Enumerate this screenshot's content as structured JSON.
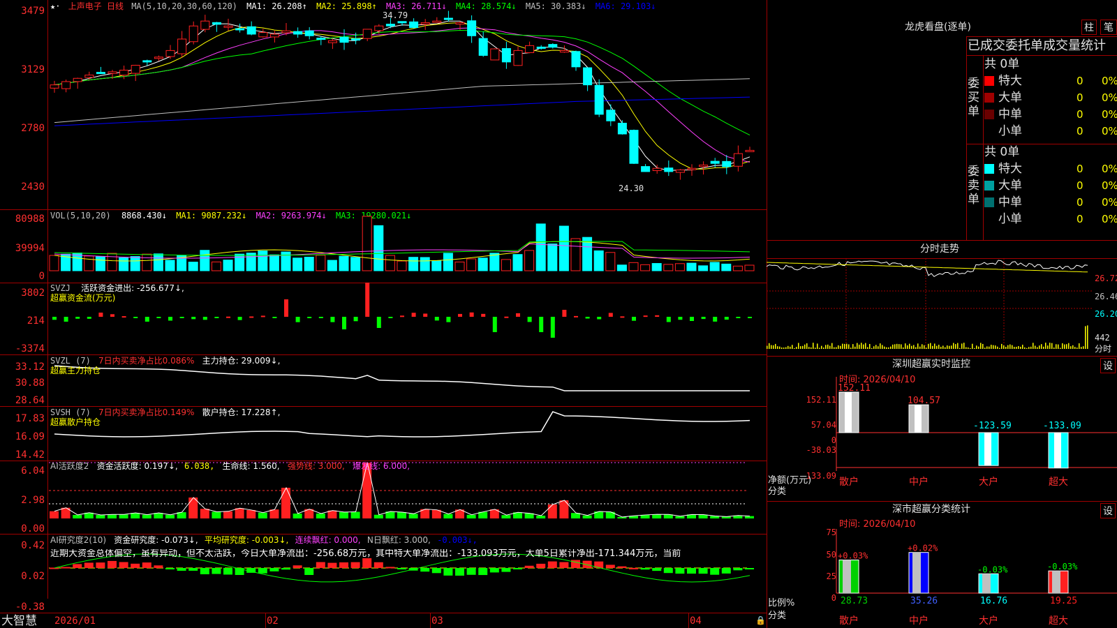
{
  "header": {
    "stock_name": "上声电子",
    "period": "日线",
    "ma_title": "MA(5,10,20,30,60,120)",
    "ma_values": [
      "MA1: 26.208↑",
      "MA2: 25.898↑",
      "MA3: 26.711↓",
      "MA4: 28.574↓",
      "MA5: 30.383↓",
      "MA6: 29.103↓"
    ],
    "high_label": "34.79",
    "low_label": "24.30"
  },
  "price_axis": [
    "3479",
    "3129",
    "2780",
    "2430"
  ],
  "vol": {
    "title": "VOL(5,10,20)",
    "value": "8868.430↓",
    "ma": [
      "MA1: 9087.232↓",
      "MA2: 9263.974↓",
      "MA3: 19280.021↓"
    ],
    "axis": [
      "80988",
      "39994",
      "0"
    ]
  },
  "svzj": {
    "title": "SVZJ",
    "label": "活跃资金进出: -256.677↓,",
    "subtitle": "超赢资金流(万元)",
    "axis": [
      "3802",
      "214",
      "-3374"
    ]
  },
  "svzl": {
    "title": "SVZL (7)",
    "ratio": "7日内买卖净占比0.086%",
    "hold": "主力持仓: 29.009↓,",
    "subtitle": "超赢主力持仓",
    "axis": [
      "33.12",
      "30.88",
      "28.64"
    ]
  },
  "svsh": {
    "title": "SVSH (7)",
    "ratio": "7日内买卖净占比0.149%",
    "hold": "散户持仓: 17.228↑,",
    "subtitle": "超赢散户持仓",
    "axis": [
      "17.83",
      "16.09",
      "14.42"
    ]
  },
  "ai_active": {
    "title": "AI活跃度2",
    "a": "资金活跃度: 0.197↓,",
    "b": "6.038,",
    "c": "生命线: 1.560,",
    "d": "强势线: 3.000,",
    "e": "爆发线: 6.000,",
    "axis": [
      "6.04",
      "2.98",
      "0.00"
    ]
  },
  "ai_research": {
    "title": "AI研究度2(10)",
    "a": "资金研究度: -0.073↓,",
    "b": "平均研究度: -0.003↓,",
    "c": "连续飘红: 0.000,",
    "d": "N日飘红: 3.000,",
    "e": "-0.003↓,",
    "summary": "近期大资金总体偏空，虽有异动，但不太活跃，今日大单净流出：-256.68万元，其中特大单净流出：-133.093万元，大单5日累计净出-171.344万元，当前",
    "axis": [
      "0.42",
      "0.02",
      "-0.38"
    ]
  },
  "bottom": {
    "brand": "大智慧",
    "dates": [
      "2026/01",
      "02",
      "03",
      "04"
    ]
  },
  "lhb": {
    "title": "龙虎看盘(逐单)",
    "btn_zhu": "柱",
    "btn_bi": "笔",
    "header": "已成交委托单成交量统计",
    "buy_label": "委买单",
    "sell_label": "委卖单",
    "buy_total": "共 0单",
    "sell_total": "共 0单",
    "buy_rows": [
      {
        "name": "特大",
        "value": "0",
        "pct": "0%",
        "color": "#ff0000"
      },
      {
        "name": "大单",
        "value": "0",
        "pct": "0%",
        "color": "#a00000"
      },
      {
        "name": "中单",
        "value": "0",
        "pct": "0%",
        "color": "#6a0000"
      },
      {
        "name": "小单",
        "value": "0",
        "pct": "0%",
        "color": "#000000"
      }
    ],
    "sell_rows": [
      {
        "name": "特大",
        "value": "0",
        "pct": "0%",
        "color": "#00ffff"
      },
      {
        "name": "大单",
        "value": "0",
        "pct": "0%",
        "color": "#00a0a0"
      },
      {
        "name": "中单",
        "value": "0",
        "pct": "0%",
        "color": "#007070"
      },
      {
        "name": "小单",
        "value": "0",
        "pct": "0%",
        "color": "#000000"
      }
    ]
  },
  "intraday": {
    "title": "分时走势",
    "axis": [
      "26.72",
      "26.46",
      "26.20"
    ],
    "vol_label": "442",
    "vol_unit": "分时"
  },
  "monitor": {
    "title": "深圳超赢实时监控",
    "btn": "设",
    "time": "时间: 2026/04/10",
    "axis": [
      "152.11",
      "57.04",
      "0",
      "-38.03",
      "-133.09"
    ],
    "ylabel": "净额(万元)",
    "xlabel": "分类"
  },
  "classify": {
    "title": "深市超赢分类统计",
    "btn": "设",
    "time": "时间: 2026/04/10",
    "axis": [
      "75",
      "50",
      "25",
      "0"
    ],
    "ylabel": "比例%",
    "xlabel": "分类"
  },
  "chart_data": [
    {
      "type": "bar",
      "title": "深圳超赢实时监控",
      "categories": [
        "散户",
        "中户",
        "大户",
        "超大"
      ],
      "values": [
        152.11,
        104.57,
        -123.59,
        -133.09
      ],
      "value_labels": [
        "152.11",
        "104.57",
        "-123.59",
        "-133.09"
      ],
      "ylim": [
        -133.09,
        152.11
      ]
    },
    {
      "type": "bar",
      "title": "深市超赢分类统计",
      "categories": [
        "散户",
        "中户",
        "大户",
        "超大"
      ],
      "values": [
        28.73,
        35.26,
        16.76,
        19.25
      ],
      "value_labels": [
        "28.73",
        "35.26",
        "16.76",
        "19.25"
      ],
      "change_labels": [
        "+0.03%",
        "+0.02%",
        "-0.03%",
        "-0.03%"
      ],
      "colors": [
        "#00d000",
        "#0000ff",
        "#00ffff",
        "#ff2020"
      ],
      "ylim": [
        0,
        75
      ]
    }
  ]
}
